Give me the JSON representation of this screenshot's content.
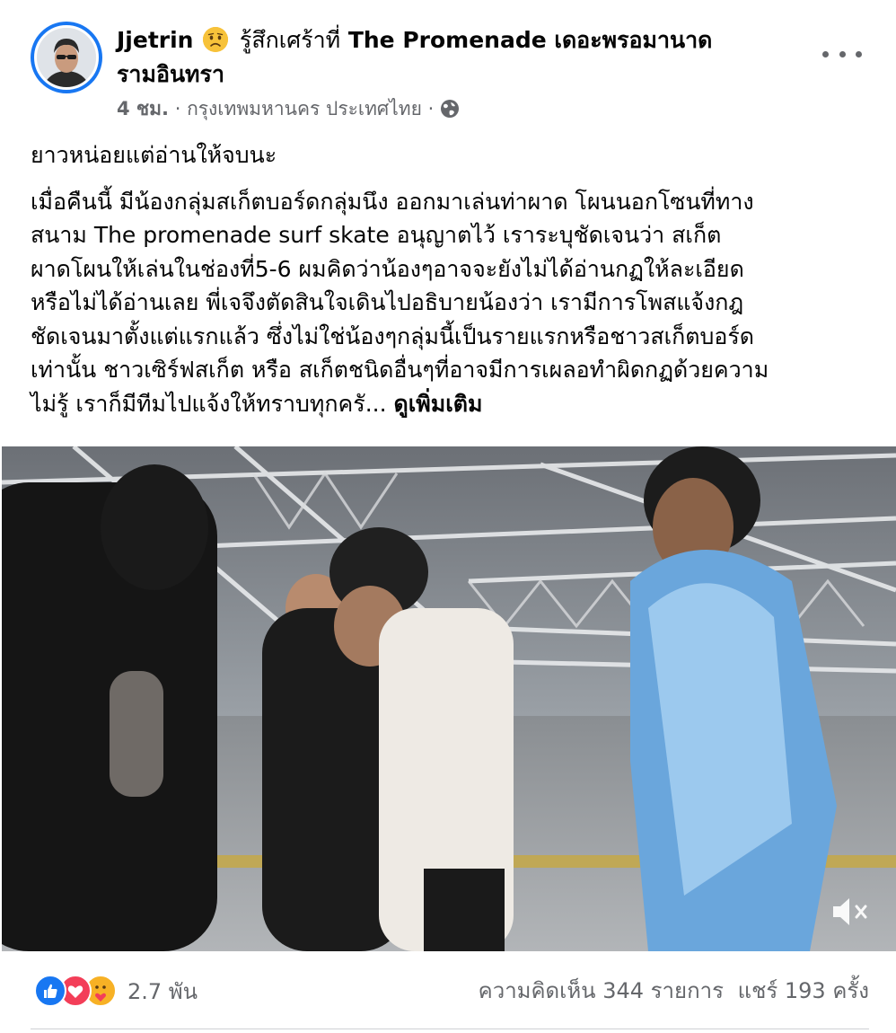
{
  "post": {
    "author": "Jjetrin",
    "feeling_text": "รู้สึกเศร้าที่",
    "place_line1": "The Promenade เดอะพรอมานาด",
    "place_line2": "รามอินทรา",
    "time": "4 ชม.",
    "location": "กรุงเทพมหานคร ประเทศไทย",
    "separator": "·",
    "privacy_icon": "globe-icon",
    "lead": "ยาวหน่อยแต่อ่านให้จบนะ",
    "body_lines": [
      "เมื่อคืนนี้ มีน้องกลุ่มสเก็ตบอร์ดกลุ่มนึง ออกมาเล่นท่าผาด โผนนอกโซนที่ทาง",
      "สนาม The promenade surf skate อนุญาตไว้ เราระบุชัดเจนว่า สเก็ต",
      "ผาดโผนให้เล่นในช่องที่5-6 ผมคิดว่าน้องๆอาจจะยังไม่ได้อ่านกฏให้ละเอียด",
      "หรือไม่ได้อ่านเลย พี่เจจึงตัดสินใจเดินไปอธิบายน้องว่า เรามีการโพสแจ้งกฎ",
      "ชัดเจนมาตั้งแต่แรกแล้ว ซึ่งไม่ใช่น้องๆกลุ่มนี้เป็นรายแรกหรือชาวสเก็ตบอร์ด",
      "เท่านั้น ชาวเซิร์ฟสเก็ต หรือ สเก็ตชนิดอื่นๆที่อาจมีการเผลอทำผิดกฏด้วยความ",
      "ไม่รู้ เราก็มีทีมไปแจ้งให้ทราบทุกครั... "
    ],
    "see_more": "ดูเพิ่มเติม"
  },
  "video": {
    "mute_icon": "volume-muted-icon"
  },
  "footer": {
    "reaction_icons": [
      "like-icon",
      "love-icon",
      "care-icon"
    ],
    "reaction_count": "2.7 พัน",
    "comments": "ความคิดเห็น 344 รายการ",
    "shares": "แชร์ 193 ครั้ง"
  },
  "colors": {
    "brand_blue": "#1877f2",
    "love_red": "#f33e58",
    "care_yellow": "#f7b125",
    "meta_gray": "#65676b"
  }
}
